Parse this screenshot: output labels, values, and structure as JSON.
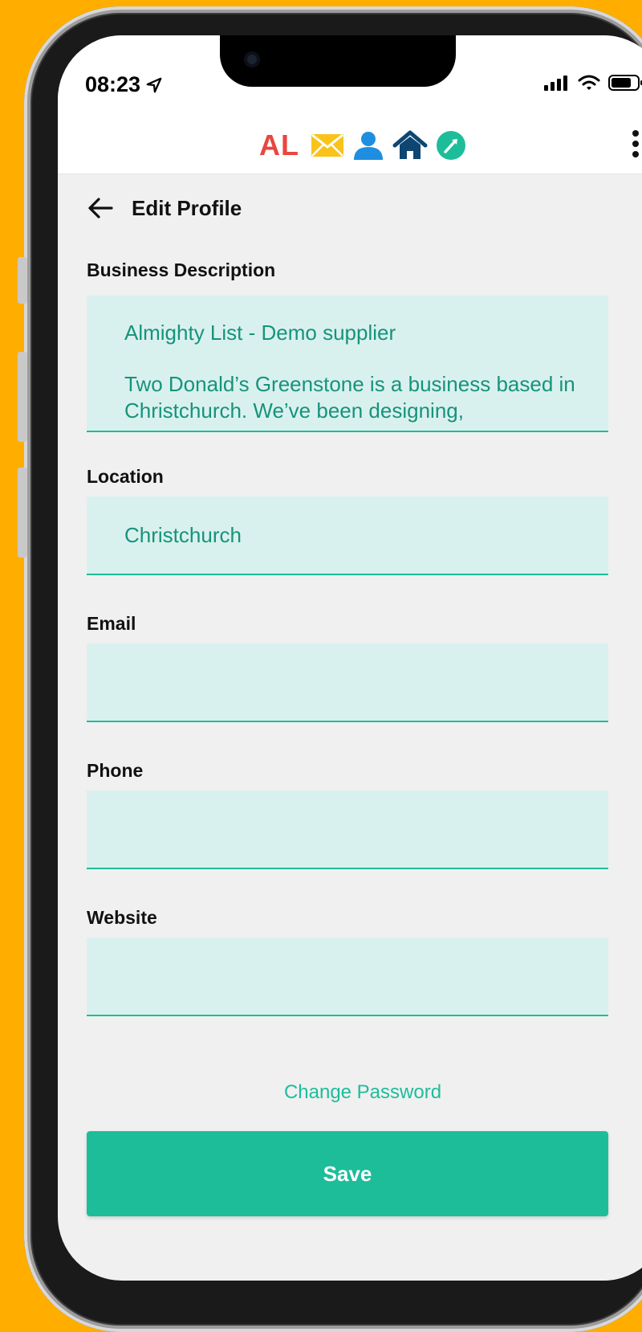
{
  "status_bar": {
    "time": "08:23"
  },
  "app_bar": {
    "logo_text": "AL",
    "colors": {
      "logo_red": "#E9463F",
      "mail_yellow": "#F9C31A",
      "person_blue": "#1E8FE0",
      "home_navy": "#0E4671",
      "tool_teal": "#1DBD9A"
    },
    "icons": [
      "mail-icon",
      "person-icon",
      "home-icon",
      "tool-icon",
      "more-vertical-icon"
    ]
  },
  "page": {
    "title": "Edit Profile"
  },
  "form": {
    "business_description": {
      "label": "Business Description",
      "lines": [
        "Almighty List - Demo supplier",
        "Two Donald’s Greenstone is a business based in Christchurch. We’ve been designing,"
      ]
    },
    "location": {
      "label": "Location",
      "value": "Christchurch"
    },
    "email": {
      "label": "Email",
      "value": ""
    },
    "phone": {
      "label": "Phone",
      "value": ""
    },
    "website": {
      "label": "Website",
      "value": ""
    }
  },
  "actions": {
    "change_password": "Change Password",
    "save": "Save"
  },
  "theme": {
    "accent": "#1DBD9A",
    "field_bg": "#D9F1EE",
    "field_text": "#16937C",
    "page_bg": "#F0F0F0",
    "frame_bg": "#FFAE00"
  }
}
